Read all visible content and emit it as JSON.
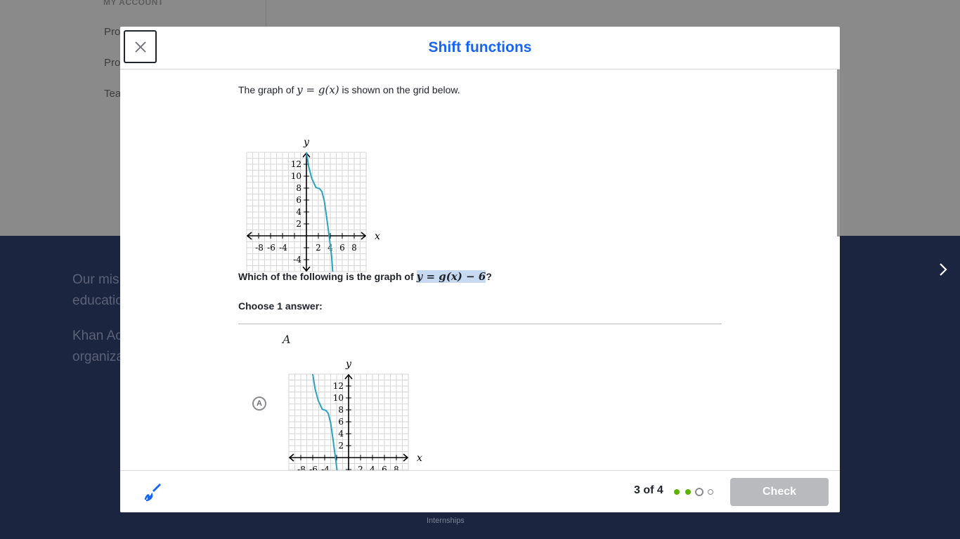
{
  "background": {
    "sidebar_section": "MY ACCOUNT",
    "sidebar_links": [
      "Pro",
      "Pro",
      "Tea"
    ],
    "mission_lines": [
      "Our mis",
      "educatio"
    ],
    "mission2_lines": [
      "Khan Ac",
      "organiza"
    ],
    "footer_link": "Internships"
  },
  "modal": {
    "title": "Shift functions",
    "question": {
      "intro_before": "The graph of ",
      "intro_math": "y = g(x)",
      "intro_after": " is shown on the grid below.",
      "prompt_before": "Which of the following is the graph of ",
      "prompt_math": "y = g(x) − 6",
      "prompt_after": "?",
      "choose": "Choose 1 answer:"
    },
    "choices": [
      {
        "marker": "A",
        "label": "A"
      }
    ],
    "footer": {
      "progress": "3 of 4",
      "check_label": "Check",
      "dots": [
        "complete",
        "complete",
        "current",
        "upcoming"
      ]
    }
  },
  "colors": {
    "accent": "#1865f2",
    "curve": "#29a2c2",
    "dot_complete": "#5cb300",
    "check_disabled": "#b9babd",
    "bg_dark": "#1c2540"
  },
  "icons": {
    "close": "close-icon",
    "scratchpad": "pencil-scribble-icon",
    "next": "chevron-right-icon"
  },
  "graphs": {
    "ticks": {
      "x_left": [
        "-8",
        "-6",
        "-4"
      ],
      "x_right": [
        "2",
        "4",
        "6",
        "8"
      ],
      "y_up": [
        "12",
        "10",
        "8",
        "6",
        "4",
        "2"
      ],
      "y_down": [
        "-4"
      ]
    },
    "axis_labels": {
      "x": "x",
      "y": "y"
    }
  }
}
